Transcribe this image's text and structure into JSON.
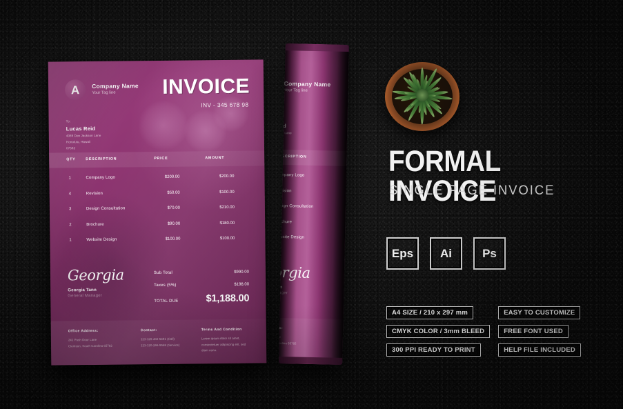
{
  "product": {
    "title": "FORMAL INVOICE",
    "subtitle": "SINGLE PAGE INVOICE"
  },
  "formats": [
    {
      "label": "Eps",
      "name": "format-badge-eps"
    },
    {
      "label": "Ai",
      "name": "format-badge-ai"
    },
    {
      "label": "Ps",
      "name": "format-badge-ps"
    }
  ],
  "features": [
    "A4 SIZE / 210 x 297 mm",
    "EASY TO CUSTOMIZE",
    "CMYK COLOR / 3mm BLEED",
    "FREE FONT USED",
    "300 PPI READY TO PRINT",
    "HELP FILE INCLUDED"
  ],
  "invoice": {
    "logo_letter": "A",
    "company_name": "Company Name",
    "tagline": "Your Tag line",
    "title": "INVOICE",
    "number": "INV - 345 678 98",
    "bill_to_label": "To:",
    "bill_to_name": "Lucas Reid",
    "bill_to_address_lines": [
      "4089  Don Jackson Lane",
      "Honolulu, Hawaii",
      "07682"
    ],
    "table_headers": {
      "qty": "QTY",
      "description": "DESCRIPTION",
      "price": "PRICE",
      "amount": "AMOUNT"
    },
    "line_items": [
      {
        "qty": "1",
        "description": "Company Logo",
        "price": "$200.00",
        "amount": "$200.00"
      },
      {
        "qty": "4",
        "description": "Revision",
        "price": "$50.00",
        "amount": "$100.00"
      },
      {
        "qty": "3",
        "description": "Design Consultation",
        "price": "$70.00",
        "amount": "$210.00"
      },
      {
        "qty": "2",
        "description": "Brochure",
        "price": "$90.00",
        "amount": "$180.00"
      },
      {
        "qty": "1",
        "description": "Website Design",
        "price": "$100.00",
        "amount": "$100.00"
      }
    ],
    "totals": [
      {
        "label": "Sub Total",
        "value": "$990.00"
      },
      {
        "label": "Taxes (5%)",
        "value": "$198.00"
      },
      {
        "label": "TOTAL DUE",
        "value": "$1,188.00"
      }
    ],
    "signature_script": "Georgia",
    "signature_name": "Georgia Tann",
    "signature_role": "General Manager",
    "footer": {
      "office_title": "Office Address:",
      "office_lines": "241 Push Door Lane\nClemson, South Carolina 65782",
      "contact_title": "Contact:",
      "contact_lines": "123-120-432-5491 (Call)\n123-120-266-5568 (Service)",
      "terms_title": "Terms And Condition",
      "terms_lines": "Lorem ipsum dolor sit amet, consectetuer adipiscing elit, sed diam nonu."
    }
  },
  "colors": {
    "sheet_purple": "#8e3571",
    "background": "#0e0e0e",
    "text_light": "#f2f2f2"
  }
}
